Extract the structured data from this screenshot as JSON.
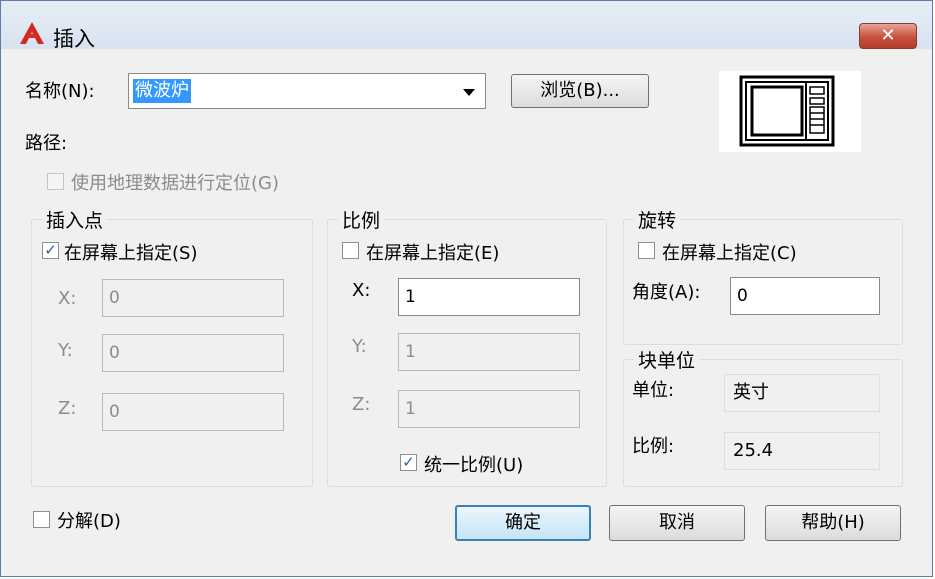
{
  "window": {
    "title": "插入",
    "close_glyph": "✕"
  },
  "name_row": {
    "label": "名称(N):",
    "value": "微波炉",
    "browse_label": "浏览(B)..."
  },
  "path": {
    "label": "路径:"
  },
  "geo": {
    "label": "使用地理数据进行定位(G)",
    "checked": false
  },
  "insert_point": {
    "title": "插入点",
    "specify": {
      "label": "在屏幕上指定(S)",
      "checked": true
    },
    "x": {
      "label": "X:",
      "value": "0"
    },
    "y": {
      "label": "Y:",
      "value": "0"
    },
    "z": {
      "label": "Z:",
      "value": "0"
    }
  },
  "scale": {
    "title": "比例",
    "specify": {
      "label": "在屏幕上指定(E)",
      "checked": false
    },
    "x": {
      "label": "X:",
      "value": "1"
    },
    "y": {
      "label": "Y:",
      "value": "1"
    },
    "z": {
      "label": "Z:",
      "value": "1"
    },
    "uniform": {
      "label": "统一比例(U)",
      "checked": true
    }
  },
  "rotation": {
    "title": "旋转",
    "specify": {
      "label": "在屏幕上指定(C)",
      "checked": false
    },
    "angle": {
      "label": "角度(A):",
      "value": "0"
    }
  },
  "block_unit": {
    "title": "块单位",
    "unit": {
      "label": "单位:",
      "value": "英寸"
    },
    "factor": {
      "label": "比例:",
      "value": "25.4"
    }
  },
  "explode": {
    "label": "分解(D)",
    "checked": false
  },
  "buttons": {
    "ok": "确定",
    "cancel": "取消",
    "help": "帮助(H)"
  },
  "icons": {
    "app": "autocad-a-icon",
    "check": "✓"
  },
  "colors": {
    "selection": "#3399ff",
    "close": "#c7513f",
    "titlebar": "#dbe6f2"
  }
}
